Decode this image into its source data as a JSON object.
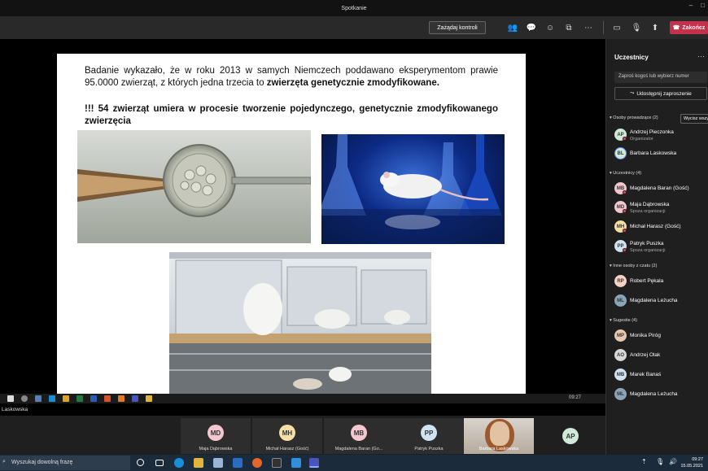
{
  "window": {
    "title": "Spotkanie"
  },
  "toolbar": {
    "request_control": "Zażądaj kontroli",
    "end_label": "Zakończ"
  },
  "slide": {
    "p1_text": "Badanie wykazało, że w roku 2013 w samych Niemczech poddawano eksperymentom prawie 95.0000 zwierząt, z których jedna trzecia to ",
    "p1_bold": "zwierzęta genetycznie zmodyfikowane.",
    "p2": "!!! 54 zwierząt umiera w procesie tworzenie pojedynczego, genetycznie zmodyfikowanego zwierzęcia"
  },
  "inner_taskbar": {
    "time": "09:27"
  },
  "sharer": "Laskowska",
  "strip": [
    {
      "initials": "MD",
      "name": "Maja Dąbrowska",
      "color": "#f4c7d0"
    },
    {
      "initials": "MH",
      "name": "Michał Harasz (Gość)",
      "color": "#f4dfa6"
    },
    {
      "initials": "MB",
      "name": "Magdalena Baran (Go...",
      "color": "#f4c7d0"
    },
    {
      "initials": "PP",
      "name": "Patryk Puszka",
      "color": "#cfe3f0"
    },
    {
      "initials": "",
      "name": "Barbara Laskowska",
      "color": ""
    },
    {
      "initials": "AP",
      "name": "",
      "color": "#cfead8"
    }
  ],
  "sidebar": {
    "title": "Uczestnicy",
    "invite_placeholder": "Zaproś kogoś lub wybierz numer",
    "share_invite": "Udostępnij zaproszenie",
    "mute_all": "Wycisz wszystkich",
    "sections": {
      "presenters": "Osoby prowadzące (2)",
      "attendees": "Uczestnicy (4)",
      "chat_others": "Inne osoby z czatu (2)",
      "suggestions": "Sugestie (4)"
    },
    "presenters": [
      {
        "initials": "AP",
        "name": "Andrzej Pieczonka",
        "role": "Organizator",
        "color": "#cfead8"
      },
      {
        "initials": "BL",
        "name": "Barbara Laskowska",
        "role": "",
        "color": "#cfead8"
      }
    ],
    "attendees": [
      {
        "initials": "MB",
        "name": "Magdalena Baran (Gość)",
        "role": "",
        "color": "#f4c7d0"
      },
      {
        "initials": "MD",
        "name": "Maja Dąbrowska",
        "role": "Spoza organizacji",
        "color": "#f4c7d0"
      },
      {
        "initials": "MH",
        "name": "Michał Harasz (Gość)",
        "role": "",
        "color": "#f4dfa6"
      },
      {
        "initials": "PP",
        "name": "Patryk Puszka",
        "role": "Spoza organizacji",
        "color": "#cfe3f0"
      }
    ],
    "chat_others": [
      {
        "initials": "RP",
        "name": "Robert Pękala",
        "role": "",
        "color": "#f4d3c4"
      },
      {
        "initials": "ML",
        "name": "Magdalena Leżucha",
        "role": "",
        "color": "#8aa4b8"
      }
    ],
    "suggestions": [
      {
        "initials": "MP",
        "name": "Monika Piróg",
        "role": "",
        "color": "#e8c9b0"
      },
      {
        "initials": "AO",
        "name": "Andrzej Olak",
        "role": "",
        "color": "#d8d8d8"
      },
      {
        "initials": "MB",
        "name": "Marek Banaś",
        "role": "",
        "color": "#cfe3f0"
      },
      {
        "initials": "ML",
        "name": "Magdalena Leżucha",
        "role": "",
        "color": "#8aa4b8"
      }
    ]
  },
  "taskbar": {
    "search_placeholder": "Wyszukaj dowolną frazę",
    "time": "09:27",
    "date": "15.05.2021"
  }
}
